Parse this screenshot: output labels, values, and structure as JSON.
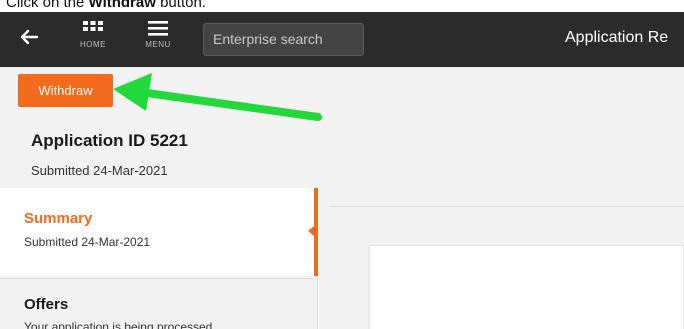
{
  "instruction": {
    "prefix": "Click on the ",
    "target": "Withdraw",
    "suffix": " button."
  },
  "topbar": {
    "home_label": "HOME",
    "menu_label": "MENU",
    "search_placeholder": "Enterprise search",
    "title": "Application Re"
  },
  "header": {
    "withdraw_label": "Withdraw",
    "application_id": "Application ID 5221",
    "submitted": "Submitted 24-Mar-2021"
  },
  "sidebar": {
    "items": [
      {
        "title": "Summary",
        "subtitle": "Submitted 24-Mar-2021"
      },
      {
        "title": "Offers",
        "subtitle": "Your application is being processed"
      }
    ]
  },
  "colors": {
    "accent": "#f26b1d",
    "topbar": "#2b2b2b",
    "callout_arrow": "#22d83a"
  },
  "icons": [
    "back-arrow-icon",
    "home-grid-icon",
    "menu-hamburger-icon"
  ]
}
